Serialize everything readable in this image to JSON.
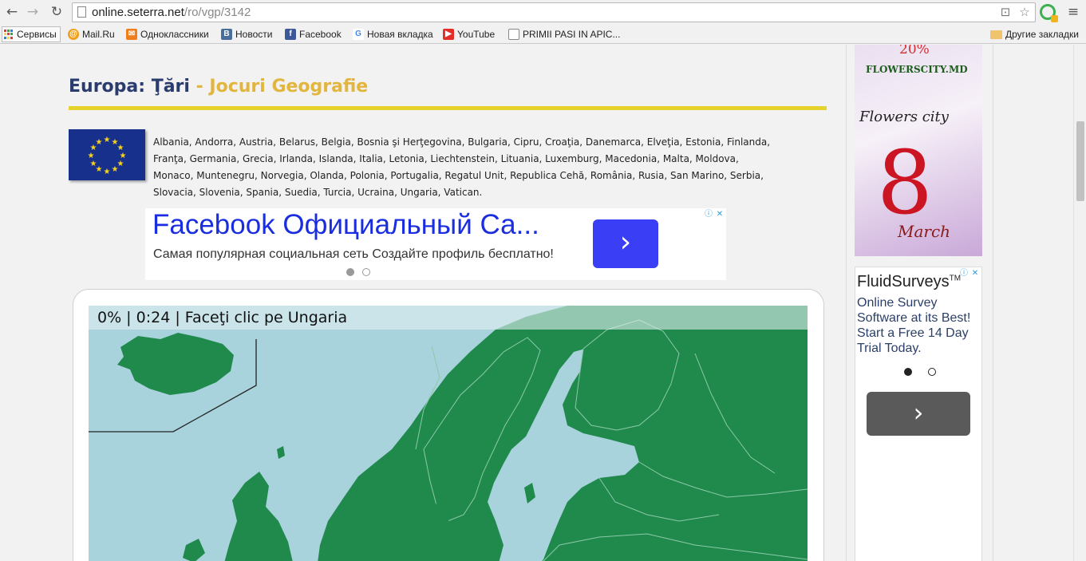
{
  "browser": {
    "url_host": "online.seterra.net",
    "url_path": "/ro/vgp/3142",
    "bookmarks": [
      {
        "label": "Сервисы",
        "icon": "apps-icon"
      },
      {
        "label": "Mail.Ru",
        "icon": "mailru-icon",
        "color": "#f0a01a"
      },
      {
        "label": "Одноклассники",
        "icon": "ok-icon",
        "color": "#f07f1b"
      },
      {
        "label": "Новости",
        "icon": "vk-icon",
        "color": "#4a6e9c"
      },
      {
        "label": "Facebook",
        "icon": "facebook-icon",
        "color": "#3b5998"
      },
      {
        "label": "Новая вкладка",
        "icon": "google-icon",
        "color": "#4285f4"
      },
      {
        "label": "YouTube",
        "icon": "youtube-icon",
        "color": "#e52d27"
      },
      {
        "label": "PRIMII PASI IN APIC...",
        "icon": "page-icon"
      }
    ],
    "other_bookmarks": "Другие закладки"
  },
  "page": {
    "title_main": "Europa: Ţări",
    "title_sub": " - Jocuri Geografie",
    "countries_text": "Albania, Andorra, Austria, Belarus, Belgia, Bosnia şi Herţegovina, Bulgaria, Cipru, Croaţia, Danemarca, Elveţia, Estonia, Finlanda, Franţa, Germania, Grecia, Irlanda, Islanda, Italia, Letonia, Liechtenstein, Lituania, Luxemburg, Macedonia, Malta, Moldova, Monaco, Muntenegru, Norvegia, Olanda, Polonia, Portugalia, Regatul Unit, Republica Cehă, România, Rusia, San Marino, Serbia, Slovacia, Slovenia, Spania, Suedia, Turcia, Ucraina, Ungaria, Vatican.",
    "game_status": "0% | 0:24 | Faceţi clic pe Ungaria"
  },
  "ad_top": {
    "headline": "Facebook Официальный Са...",
    "description": "Самая популярная социальная сеть Создайте профиль бесплатно!",
    "arrow": "›"
  },
  "ad_right1": {
    "discount": "20%",
    "brand": "FLOWERSCITY.MD",
    "script": "Flowers city",
    "digit": "8",
    "month": "March"
  },
  "ad_right2": {
    "name": "FluidSurveys",
    "tm": "TM",
    "body": "Online Survey Software at its Best! Start a Free 14 Day Trial Today.",
    "arrow": "›"
  },
  "colors": {
    "title": "#2a3b6e",
    "title_sub": "#e2b53d",
    "underline": "#e6d32c",
    "land": "#1f8a4c",
    "sea": "#a8d3dd",
    "ad_button": "#3a3ef5"
  }
}
